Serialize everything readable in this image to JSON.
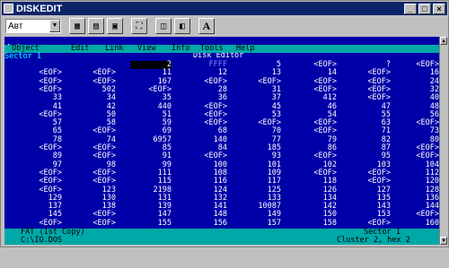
{
  "window": {
    "title": "DISKEDIT",
    "buttons": [
      "_",
      "□",
      "×"
    ]
  },
  "toolbar": {
    "font_size": "Авт",
    "letter_button": "A"
  },
  "dos": {
    "editor_title": "Disk Editor",
    "menu": [
      "Object",
      "Edit",
      "Link",
      "View",
      "Info",
      "Tools",
      "Help"
    ],
    "sector_label": "Sector 1",
    "rows": [
      [
        "",
        "",
        "2",
        "FFFF",
        "5",
        "<EOF>",
        "?",
        "<EOF>"
      ],
      [
        "<EOF>",
        "<EOF>",
        "11",
        "12",
        "13",
        "14",
        "<EOF>",
        "16"
      ],
      [
        "<EOF>",
        "<EOF>",
        "167",
        "<EOF>",
        "<EOF>",
        "<EOF>",
        "<EOF>",
        "24"
      ],
      [
        "<EOF>",
        "502",
        "<EOF>",
        "28",
        "31",
        "<EOF>",
        "<EOF>",
        "32"
      ],
      [
        "33",
        "34",
        "35",
        "36",
        "37",
        "412",
        "<EOF>",
        "40"
      ],
      [
        "41",
        "42",
        "440",
        "<EOF>",
        "45",
        "46",
        "47",
        "48"
      ],
      [
        "<EOF>",
        "50",
        "51",
        "<EOF>",
        "53",
        "54",
        "55",
        "56"
      ],
      [
        "57",
        "58",
        "59",
        "<EOF>",
        "<EOF>",
        "<EOF>",
        "63",
        "<EOF>"
      ],
      [
        "65",
        "<EOF>",
        "69",
        "68",
        "70",
        "<EOF>",
        "71",
        "73"
      ],
      [
        "78",
        "74",
        "6957",
        "140",
        "77",
        "79",
        "82",
        "80"
      ],
      [
        "<EOF>",
        "<EOF>",
        "85",
        "84",
        "185",
        "86",
        "87",
        "<EOF>"
      ],
      [
        "89",
        "<EOF>",
        "91",
        "<EOF>",
        "93",
        "<EOF>",
        "95",
        "<EOF>"
      ],
      [
        "97",
        "98",
        "99",
        "100",
        "101",
        "102",
        "103",
        "104"
      ],
      [
        "<EOF>",
        "<EOF>",
        "111",
        "108",
        "109",
        "<EOF>",
        "<EOF>",
        "112"
      ],
      [
        "<EOF>",
        "<EOF>",
        "115",
        "116",
        "117",
        "118",
        "<EOF>",
        "120"
      ],
      [
        "<EOF>",
        "123",
        "2198",
        "124",
        "125",
        "126",
        "127",
        "128"
      ],
      [
        "129",
        "130",
        "131",
        "132",
        "133",
        "134",
        "135",
        "136"
      ],
      [
        "137",
        "138",
        "139",
        "141",
        "10087",
        "142",
        "143",
        "144"
      ],
      [
        "145",
        "<EOF>",
        "147",
        "148",
        "149",
        "150",
        "153",
        "<EOF>"
      ],
      [
        "<EOF>",
        "<EOF>",
        "155",
        "156",
        "157",
        "158",
        "<EOF>",
        "160"
      ]
    ],
    "status": {
      "left1": "FAT (1st Copy)",
      "right1": "Sector 1",
      "left2": "C:\\IO.DOS",
      "right2": "Cluster 2, hex 2"
    }
  }
}
